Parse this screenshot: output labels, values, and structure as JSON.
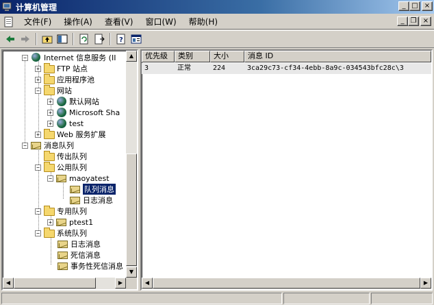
{
  "window": {
    "title": "计算机管理",
    "minimize": "_",
    "maximize": "□",
    "close": "×"
  },
  "menu": {
    "items": [
      "文件(F)",
      "操作(A)",
      "查看(V)",
      "窗口(W)",
      "帮助(H)"
    ],
    "child_minimize": "_",
    "child_restore": "❐",
    "child_close": "×"
  },
  "toolbar": {
    "icons": [
      "back-arrow-icon",
      "forward-arrow-icon",
      "up-folder-icon",
      "show-hide-tree-icon",
      "refresh-icon",
      "export-list-icon",
      "help-icon",
      "properties-icon"
    ]
  },
  "tree": {
    "nodes": [
      {
        "label": "Internet 信息服务 (II",
        "icon": "iis-icon",
        "expander": "−"
      },
      {
        "label": "FTP 站点",
        "icon": "folder-icon",
        "expander": "+"
      },
      {
        "label": "应用程序池",
        "icon": "folder-icon",
        "expander": "+"
      },
      {
        "label": "网站",
        "icon": "folder-icon",
        "expander": "−"
      },
      {
        "label": "默认网站",
        "icon": "globe-icon",
        "expander": "+"
      },
      {
        "label": "Microsoft Sha",
        "icon": "globe-icon",
        "expander": "+"
      },
      {
        "label": "test",
        "icon": "globe-icon",
        "expander": "+"
      },
      {
        "label": "Web 服务扩展",
        "icon": "folder-icon",
        "expander": "+"
      },
      {
        "label": "消息队列",
        "icon": "message-queue-icon",
        "expander": "−"
      },
      {
        "label": "传出队列",
        "icon": "folder-icon",
        "expander": ""
      },
      {
        "label": "公用队列",
        "icon": "folder-icon",
        "expander": "−"
      },
      {
        "label": "maoyatest",
        "icon": "queue-icon",
        "expander": "−"
      },
      {
        "label": "队列消息",
        "icon": "queue-messages-icon",
        "expander": ""
      },
      {
        "label": "日志消息",
        "icon": "journal-messages-icon",
        "expander": ""
      },
      {
        "label": "专用队列",
        "icon": "folder-icon",
        "expander": "−"
      },
      {
        "label": "ptest1",
        "icon": "queue-icon",
        "expander": "+"
      },
      {
        "label": "系统队列",
        "icon": "folder-icon",
        "expander": "−"
      },
      {
        "label": "日志消息",
        "icon": "journal-messages-icon",
        "expander": ""
      },
      {
        "label": "死信消息",
        "icon": "dead-letter-icon",
        "expander": ""
      },
      {
        "label": "事务性死信消息",
        "icon": "transactional-dead-letter-icon",
        "expander": ""
      }
    ],
    "selected": "队列消息"
  },
  "list": {
    "columns": [
      "优先级",
      "类别",
      "大小",
      "消息 ID"
    ],
    "rows": [
      [
        "3",
        "正常",
        "224",
        "3ca29c73-cf34-4ebb-8a9c-034543bfc28c\\3"
      ]
    ]
  },
  "colors": {
    "title_start": "#0a246a",
    "title_end": "#a6caf0",
    "selection": "#0a246a",
    "face": "#d4d0c8"
  }
}
